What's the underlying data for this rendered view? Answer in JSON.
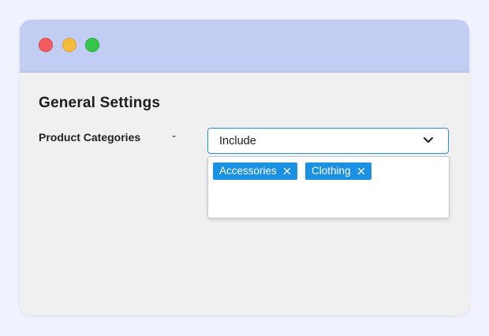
{
  "window": {
    "controls": [
      "close",
      "minimize",
      "maximize"
    ]
  },
  "page": {
    "title": "General Settings"
  },
  "field": {
    "label": "Product Categories",
    "separator": "-",
    "select_value": "Include",
    "selected_tags": [
      "Accessories",
      "Clothing"
    ]
  },
  "icons": {
    "dropdown": "chevron-down-icon",
    "tag_remove": "close-icon"
  },
  "colors": {
    "titlebar": "#c2cdf4",
    "accent": "#1a91e2",
    "select_border": "#2a8bd6"
  }
}
